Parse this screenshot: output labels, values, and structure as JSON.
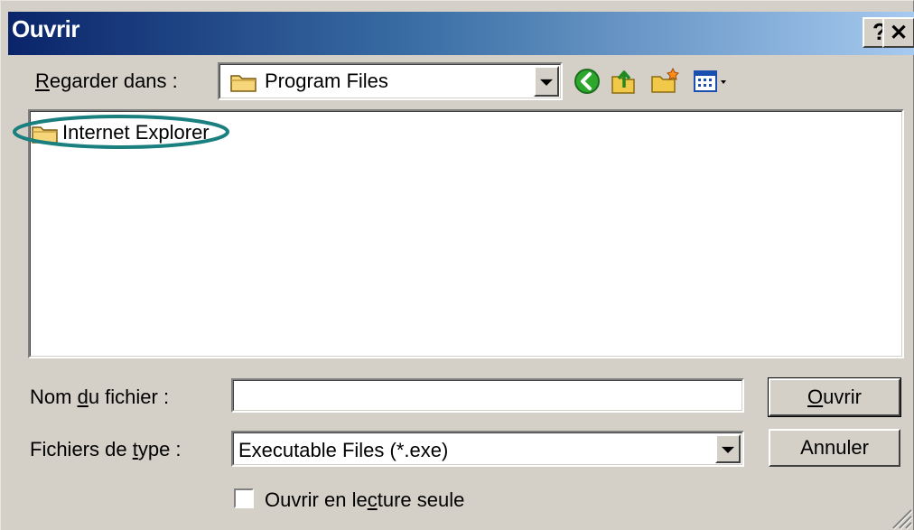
{
  "dialog": {
    "title": "Ouvrir",
    "help_glyph": "?",
    "close_glyph": "✕"
  },
  "lookin": {
    "label_prefix": "",
    "label_u": "R",
    "label_rest": "egarder dans :",
    "value": "Program Files"
  },
  "toolbar": {
    "icons": [
      "back-icon",
      "up-folder-icon",
      "new-folder-icon",
      "view-menu-icon"
    ]
  },
  "file_list": {
    "items": [
      {
        "label": "Internet Explorer",
        "icon": "folder-icon"
      }
    ],
    "highlight_color": "#1a7f7f"
  },
  "filename": {
    "label_prefix": "Nom ",
    "label_u": "d",
    "label_rest": "u fichier :",
    "value": ""
  },
  "filetype": {
    "label_prefix": "Fichiers de ",
    "label_u": "t",
    "label_rest": "ype :",
    "value": "Executable Files (*.exe)"
  },
  "buttons": {
    "open_u": "O",
    "open_rest": "uvrir",
    "cancel": "Annuler"
  },
  "readonly": {
    "label_prefix": "Ouvrir en le",
    "label_u": "c",
    "label_rest": "ture seule",
    "checked": false
  },
  "colors": {
    "title_start": "#0a246a",
    "title_end": "#a6caf0",
    "face": "#d4d0c8"
  }
}
